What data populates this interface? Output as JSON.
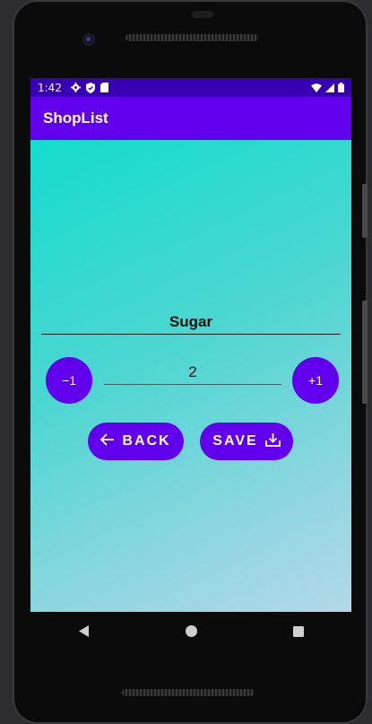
{
  "status_bar": {
    "time": "1:42",
    "icons": [
      "gear-icon",
      "shield-icon",
      "sd-card-icon"
    ],
    "right_icons": [
      "wifi-icon",
      "cell-signal-icon",
      "battery-icon"
    ],
    "background": "#3700b3"
  },
  "app_bar": {
    "title": "ShopList",
    "background": "#6200ee"
  },
  "item": {
    "name": "Sugar",
    "quantity": "2"
  },
  "stepper": {
    "decrement_label": "−1",
    "increment_label": "+1"
  },
  "actions": {
    "back_label": "BACK",
    "back_icon": "arrow-left-icon",
    "save_label": "SAVE",
    "save_icon": "download-icon"
  },
  "navigation": {
    "buttons": [
      "back-triangle-icon",
      "home-circle-icon",
      "recents-square-icon"
    ]
  },
  "colors": {
    "accent": "#6200ee",
    "gradient_start": "#14dccc",
    "gradient_end": "#b3d8e8"
  }
}
